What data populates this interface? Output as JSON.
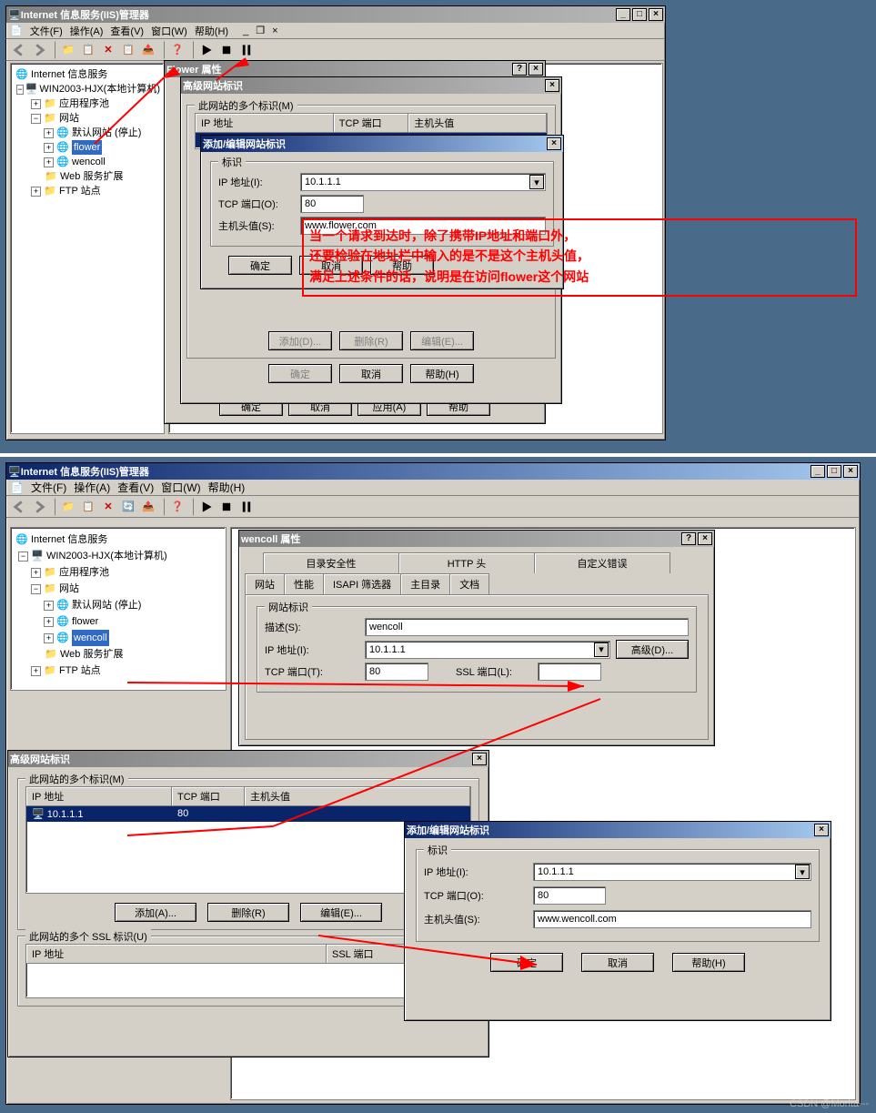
{
  "watermark": "CSDN @Morita---",
  "annotation": {
    "line1": "当一个请求到达时，除了携带IP地址和端口外，",
    "line2": "还要检验在地址栏中输入的是不是这个主机头值，",
    "line3": "满足上述条件的话，说明是在访问flower这个网站"
  },
  "top": {
    "title": "Internet 信息服务(IIS)管理器",
    "menus": [
      "文件(F)",
      "操作(A)",
      "查看(V)",
      "窗口(W)",
      "帮助(H)"
    ],
    "tree": {
      "root": "Internet 信息服务",
      "server": "WIN2003-HJX(本地计算机)",
      "apppool": "应用程序池",
      "sites": "网站",
      "site_default": "默认网站 (停止)",
      "site_flower": "flower",
      "site_wencoll": "wencoll",
      "webext": "Web 服务扩展",
      "ftp": "FTP 站点"
    },
    "flowerProps": {
      "title": "Flower 属性"
    },
    "advIdent": {
      "title": "高级网站标识",
      "multiLabel": "此网站的多个标识(M)",
      "cols": {
        "ip": "IP 地址",
        "port": "TCP 端口",
        "host": "主机头值"
      },
      "btns": {
        "add": "添加(D)...",
        "del": "删除(R)",
        "edit": "编辑(E)..."
      },
      "dlgBtns": {
        "ok": "确定",
        "cancel": "取消",
        "help": "帮助(H)"
      }
    },
    "addEdit": {
      "title": "添加/编辑网站标识",
      "grp": "标识",
      "ipLabel": "IP 地址(I):",
      "ip": "10.1.1.1",
      "portLabel": "TCP 端口(O):",
      "port": "80",
      "hostLabel": "主机头值(S):",
      "host": "www.flower.com",
      "ok": "确定",
      "cancel": "取消",
      "help": "帮助"
    },
    "propBtns": {
      "ok": "确定",
      "cancel": "取消",
      "apply": "应用(A)",
      "help": "帮助"
    }
  },
  "bottom": {
    "title": "Internet 信息服务(IIS)管理器",
    "menus": [
      "文件(F)",
      "操作(A)",
      "查看(V)",
      "窗口(W)",
      "帮助(H)"
    ],
    "tree": {
      "root": "Internet 信息服务",
      "server": "WIN2003-HJX(本地计算机)",
      "apppool": "应用程序池",
      "sites": "网站",
      "site_default": "默认网站 (停止)",
      "site_flower": "flower",
      "site_wencoll": "wencoll",
      "webext": "Web 服务扩展",
      "ftp": "FTP 站点"
    },
    "props": {
      "title": "wencoll 属性",
      "tabs_row1": [
        "目录安全性",
        "HTTP 头",
        "自定义错误"
      ],
      "tabs_row2": [
        "网站",
        "性能",
        "ISAPI 筛选器",
        "主目录",
        "文档"
      ],
      "grpIdent": "网站标识",
      "descLabel": "描述(S):",
      "desc": "wencoll",
      "ipLabel": "IP 地址(I):",
      "ip": "10.1.1.1",
      "advBtn": "高级(D)...",
      "portLabel": "TCP 端口(T):",
      "port": "80",
      "sslLabel": "SSL 端口(L):",
      "ssl": ""
    },
    "advIdent": {
      "title": "高级网站标识",
      "multiLabel": "此网站的多个标识(M)",
      "cols": {
        "ip": "IP 地址",
        "port": "TCP 端口",
        "host": "主机头值"
      },
      "row": {
        "ip": "10.1.1.1",
        "port": "80",
        "host": ""
      },
      "btns": {
        "add": "添加(A)...",
        "del": "删除(R)",
        "edit": "编辑(E)..."
      },
      "sslLabel": "此网站的多个 SSL 标识(U)",
      "sslCols": {
        "ip": "IP 地址",
        "port": "SSL 端口"
      }
    },
    "addEdit": {
      "title": "添加/编辑网站标识",
      "grp": "标识",
      "ipLabel": "IP 地址(I):",
      "ip": "10.1.1.1",
      "portLabel": "TCP 端口(O):",
      "port": "80",
      "hostLabel": "主机头值(S):",
      "host": "www.wencoll.com",
      "ok": "确定",
      "cancel": "取消",
      "help": "帮助(H)"
    }
  }
}
